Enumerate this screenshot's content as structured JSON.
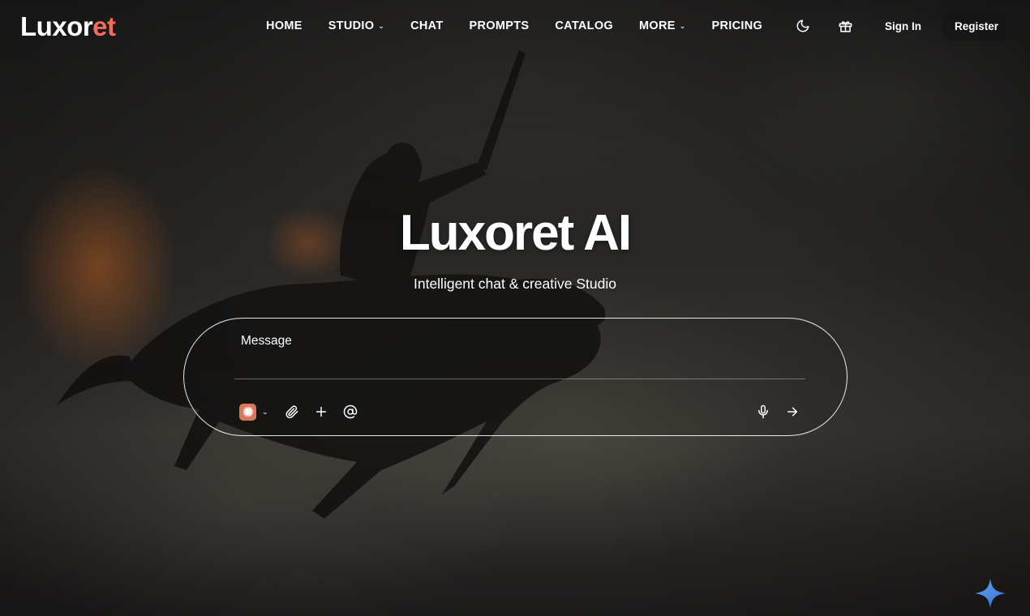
{
  "brand": {
    "logo_main": "Luxor",
    "logo_accent": "et",
    "accent_color": "#f26b5b"
  },
  "nav": {
    "items": [
      {
        "label": "HOME",
        "dropdown": false
      },
      {
        "label": "STUDIO",
        "dropdown": true
      },
      {
        "label": "CHAT",
        "dropdown": false
      },
      {
        "label": "PROMPTS",
        "dropdown": false
      },
      {
        "label": "CATALOG",
        "dropdown": false
      },
      {
        "label": "MORE",
        "dropdown": true
      },
      {
        "label": "PRICING",
        "dropdown": false
      }
    ],
    "icons": [
      "moon-icon",
      "gift-icon"
    ],
    "sign_in": "Sign In",
    "register": "Register"
  },
  "hero": {
    "title": "Luxoret AI",
    "subtitle": "Intelligent chat & creative Studio"
  },
  "chat": {
    "placeholder": "Message",
    "value": "",
    "left_tools": [
      "model-selector",
      "paperclip-icon",
      "plus-icon",
      "at-sign-icon"
    ],
    "right_tools": [
      "microphone-icon",
      "send-arrow-icon"
    ],
    "model_color": "#d9775a"
  },
  "floating": {
    "icon": "sparkle-icon"
  }
}
